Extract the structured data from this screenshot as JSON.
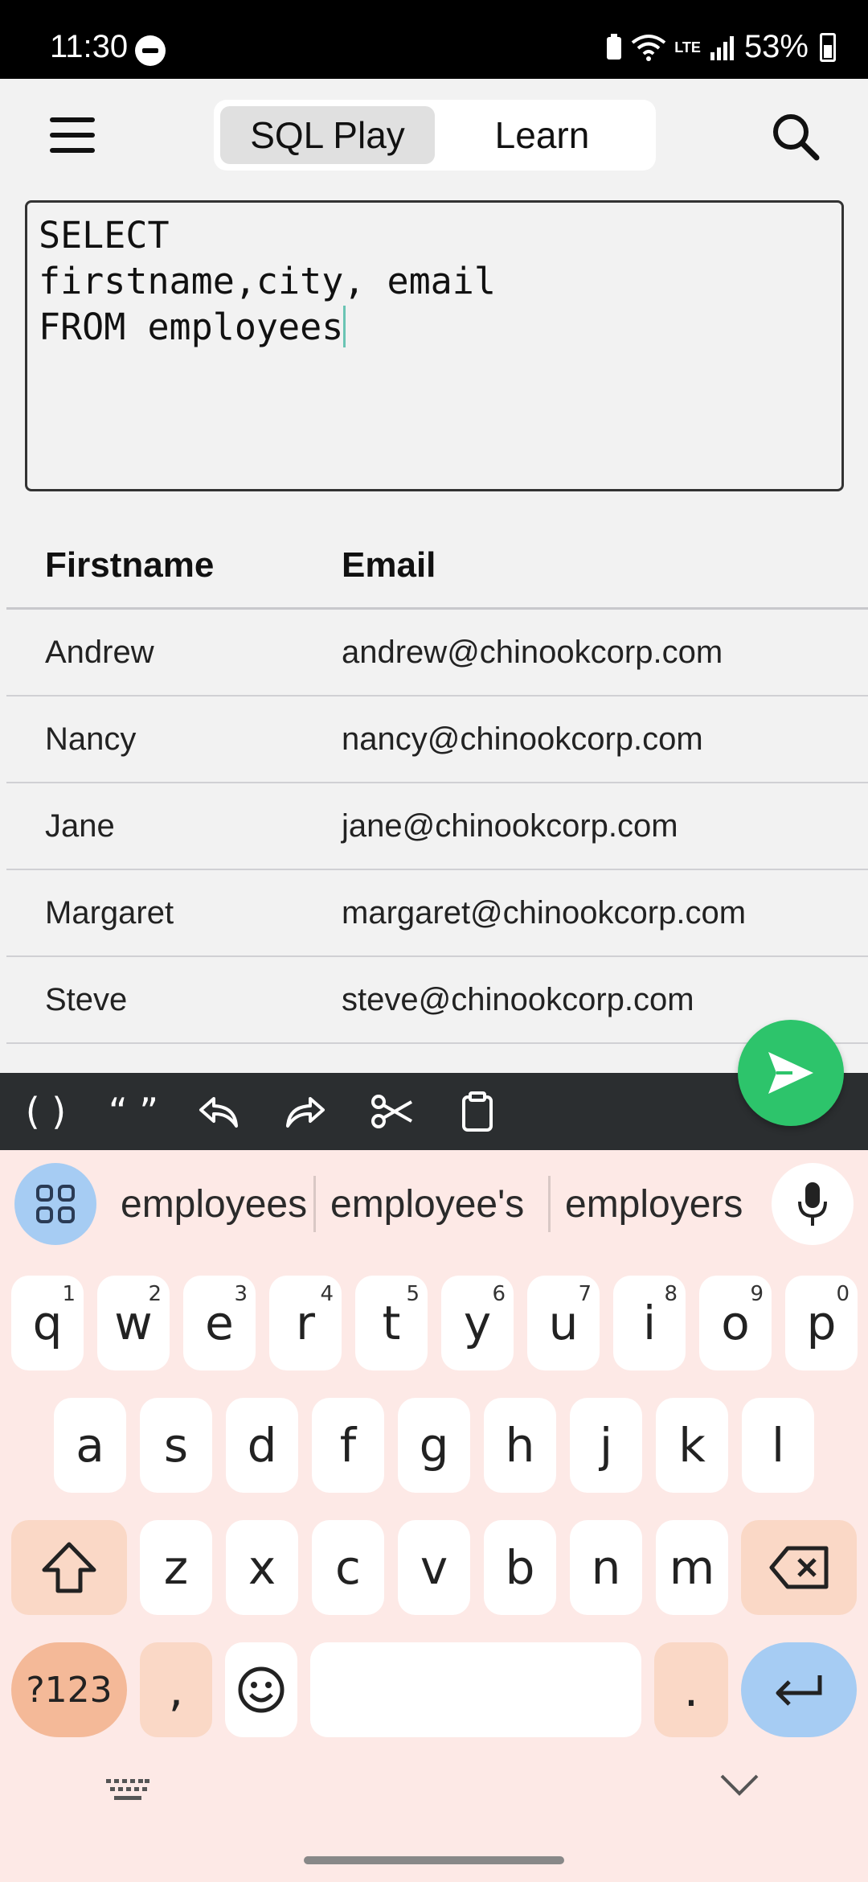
{
  "status_bar": {
    "time": "11:30",
    "battery_percent": "53%",
    "network": "LTE"
  },
  "header": {
    "tabs": [
      {
        "label": "SQL Play",
        "active": true
      },
      {
        "label": "Learn",
        "active": false
      }
    ]
  },
  "editor": {
    "lines": [
      "SELECT",
      "firstname,city, email",
      "FROM employees"
    ]
  },
  "results": {
    "columns": [
      "Firstname",
      "Email"
    ],
    "rows": [
      {
        "firstname": "Andrew",
        "email": "andrew@chinookcorp.com"
      },
      {
        "firstname": "Nancy",
        "email": "nancy@chinookcorp.com"
      },
      {
        "firstname": "Jane",
        "email": "jane@chinookcorp.com"
      },
      {
        "firstname": "Margaret",
        "email": "margaret@chinookcorp.com"
      },
      {
        "firstname": "Steve",
        "email": "steve@chinookcorp.com"
      }
    ]
  },
  "toolbar": {
    "parens_label": "( )",
    "quotes_label": "“ ”"
  },
  "keyboard": {
    "suggestions": [
      "employees",
      "employee's",
      "employers"
    ],
    "row1": [
      {
        "k": "q",
        "n": "1"
      },
      {
        "k": "w",
        "n": "2"
      },
      {
        "k": "e",
        "n": "3"
      },
      {
        "k": "r",
        "n": "4"
      },
      {
        "k": "t",
        "n": "5"
      },
      {
        "k": "y",
        "n": "6"
      },
      {
        "k": "u",
        "n": "7"
      },
      {
        "k": "i",
        "n": "8"
      },
      {
        "k": "o",
        "n": "9"
      },
      {
        "k": "p",
        "n": "0"
      }
    ],
    "row2": [
      "a",
      "s",
      "d",
      "f",
      "g",
      "h",
      "j",
      "k",
      "l"
    ],
    "row3": [
      "z",
      "x",
      "c",
      "v",
      "b",
      "n",
      "m"
    ],
    "symbols_label": "?123",
    "comma_label": ",",
    "period_label": "."
  },
  "colors": {
    "run_button": "#2dc46b",
    "toolbar_bg": "#2b2e30",
    "keyboard_bg": "#fde9e6",
    "accent_blue": "#a6ccf3"
  }
}
